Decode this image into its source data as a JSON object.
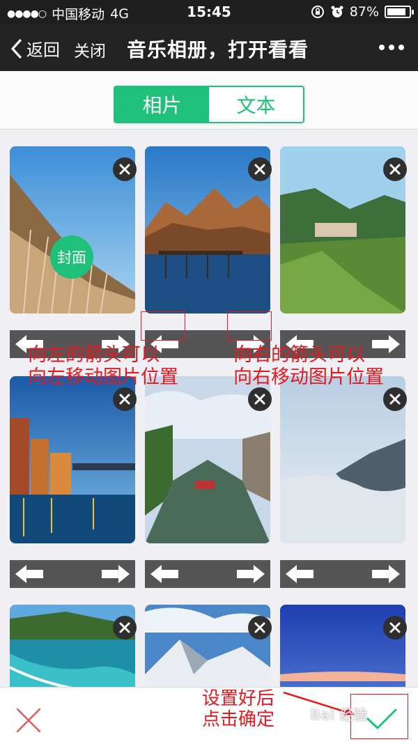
{
  "status_bar": {
    "carrier": "中国移动",
    "network": "4G",
    "time": "15:45",
    "battery": "87%",
    "battery_level": 0.87
  },
  "nav": {
    "back_label": "返回",
    "close_label": "关闭",
    "title": "音乐相册，打开看看"
  },
  "tabs": [
    {
      "label": "相片",
      "active": true
    },
    {
      "label": "文本",
      "active": false
    }
  ],
  "photos": {
    "cover_label": "封面"
  },
  "annotations": {
    "left_line1": "向左的箭头可以",
    "left_line2": "向左移动图片位置",
    "right_line1": "向右的箭头可以",
    "right_line2": "向右移动图片位置",
    "confirm_line1": "设置好后",
    "confirm_line2": "点击确定"
  },
  "watermark": "Bai 经验",
  "colors": {
    "accent": "#1ec07a",
    "annotation": "#e6191e",
    "cancel": "#e25a5a",
    "confirm": "#1ec07a"
  }
}
